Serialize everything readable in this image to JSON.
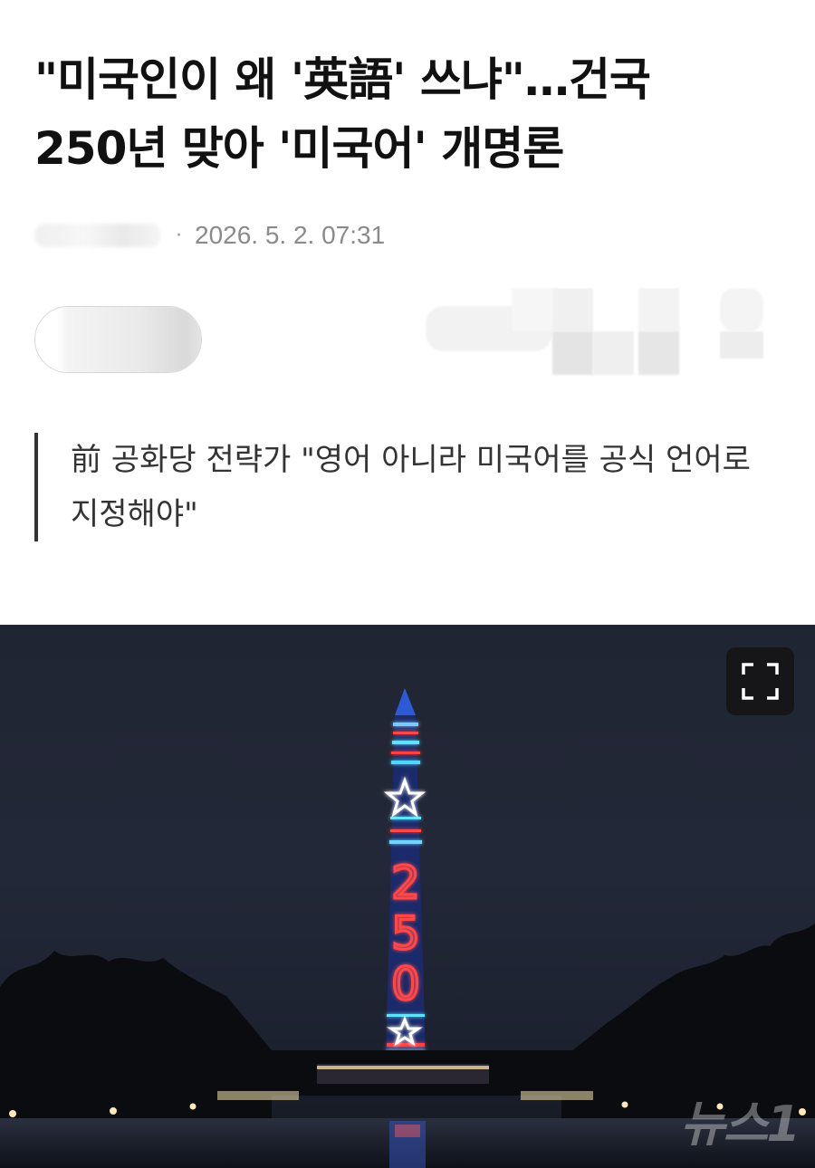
{
  "article": {
    "headline_line1": "\"미국인이 왜 '英語' 쓰냐\"…건국",
    "headline_line2": "250년 맞아 '미국어' 개명론",
    "meta": {
      "date": "2026. 5. 2. 07:31",
      "separator": "·"
    },
    "summary": "前 공화당 전략가 \"영어 아니라 미국어를 공식 언어로 지정해야\""
  },
  "photo": {
    "monument_numbers": [
      "2",
      "5",
      "0"
    ],
    "watermark": "뉴스1",
    "expand_icon": "expand-icon"
  },
  "colors": {
    "headline": "#111111",
    "meta": "#8a8a8a",
    "quote_bar": "#333333",
    "sky": "#222736",
    "neon_red": "#ff3b3b",
    "neon_blue": "#2f6bff",
    "neon_cyan": "#56e0ff"
  }
}
